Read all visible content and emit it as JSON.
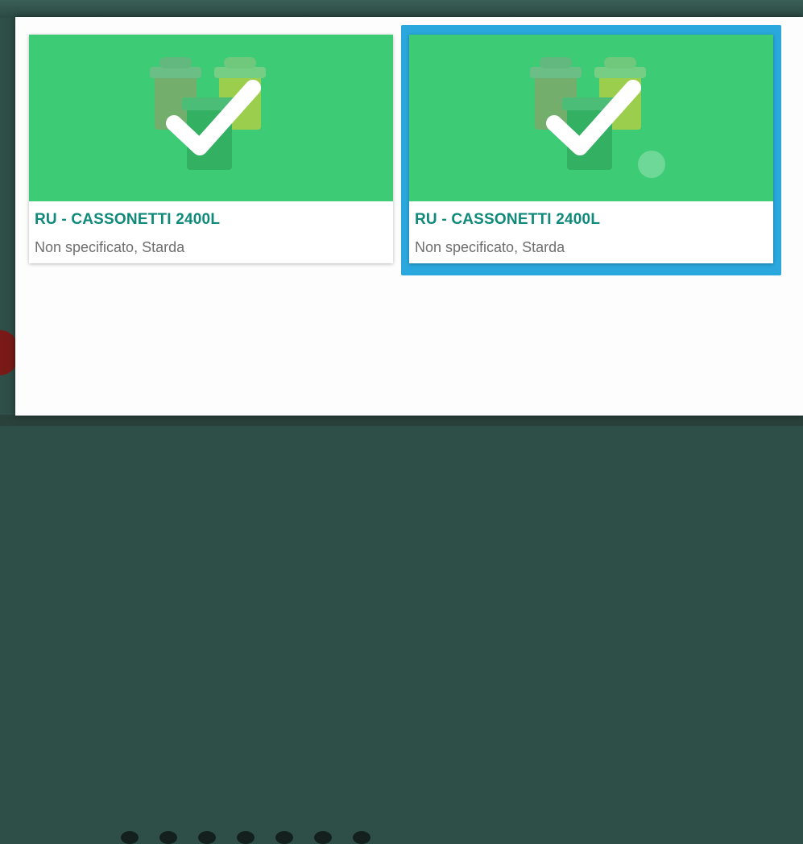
{
  "cards": [
    {
      "title": "RU - CASSONETTI 2400L",
      "subtitle": "Non specificato, Starda",
      "image_icon": "waste-bins-check-icon",
      "selected": false
    },
    {
      "title": "RU - CASSONETTI 2400L",
      "subtitle": "Non specificato, Starda",
      "image_icon": "waste-bins-check-icon",
      "selected": true
    }
  ],
  "colors": {
    "card_media": "#3ecb76",
    "title": "#0f8a7a",
    "subtitle": "#6e6e6e",
    "selection": "#2aa7dc",
    "dialog_background": "#fdfdfd"
  }
}
